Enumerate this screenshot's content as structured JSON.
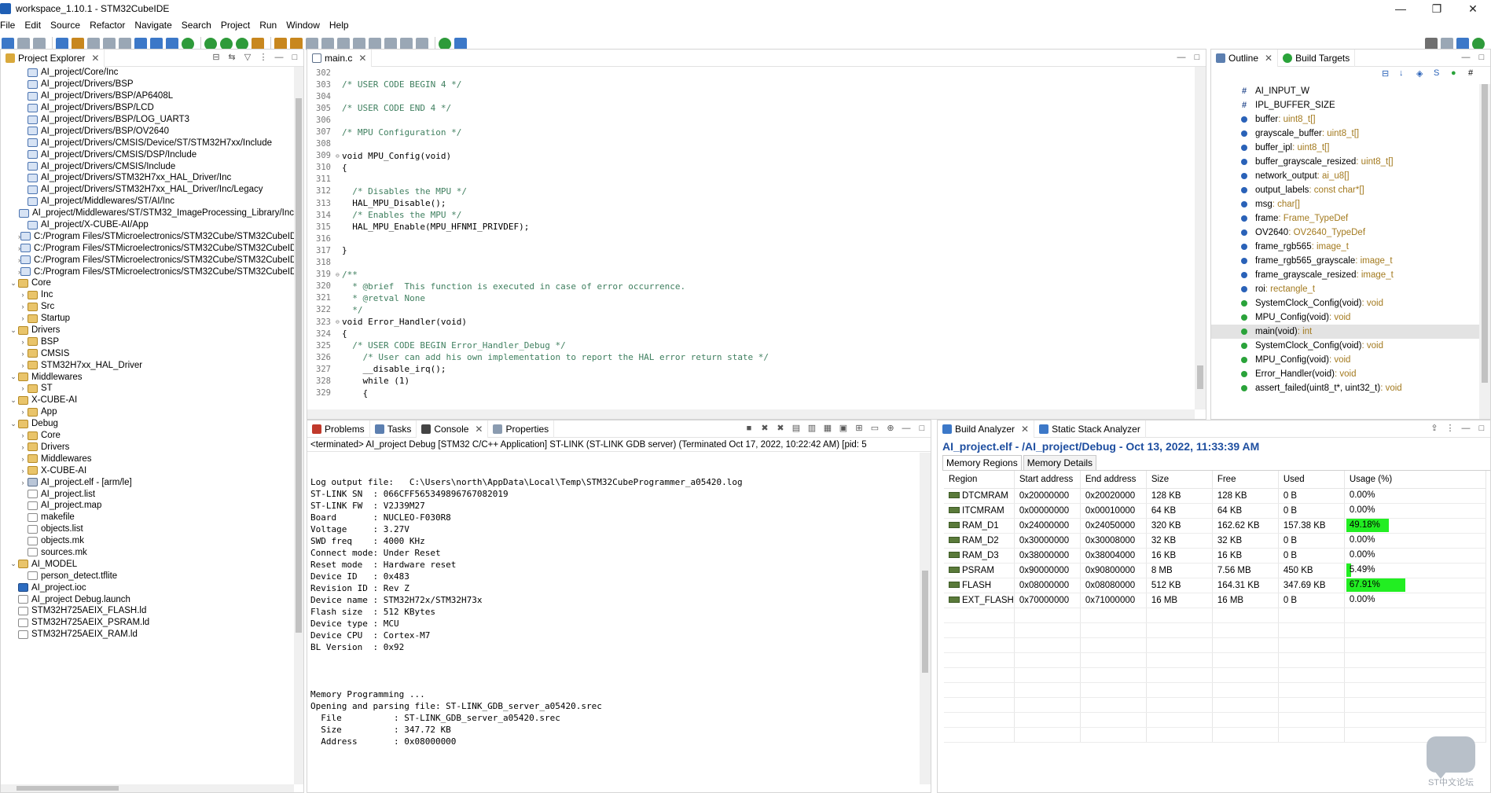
{
  "window": {
    "title": "workspace_1.10.1 - STM32CubeIDE",
    "controls": [
      "—",
      "❐",
      "✕"
    ]
  },
  "menu": [
    "File",
    "Edit",
    "Source",
    "Refactor",
    "Navigate",
    "Search",
    "Project",
    "Run",
    "Window",
    "Help"
  ],
  "project_explorer": {
    "tab": "Project Explorer",
    "items": [
      {
        "t": "AI_project/Core/Inc",
        "d": 2,
        "ic": "inc"
      },
      {
        "t": "AI_project/Drivers/BSP",
        "d": 2,
        "ic": "inc"
      },
      {
        "t": "AI_project/Drivers/BSP/AP6408L",
        "d": 2,
        "ic": "inc"
      },
      {
        "t": "AI_project/Drivers/BSP/LCD",
        "d": 2,
        "ic": "inc"
      },
      {
        "t": "AI_project/Drivers/BSP/LOG_UART3",
        "d": 2,
        "ic": "inc"
      },
      {
        "t": "AI_project/Drivers/BSP/OV2640",
        "d": 2,
        "ic": "inc"
      },
      {
        "t": "AI_project/Drivers/CMSIS/Device/ST/STM32H7xx/Include",
        "d": 2,
        "ic": "inc"
      },
      {
        "t": "AI_project/Drivers/CMSIS/DSP/Include",
        "d": 2,
        "ic": "inc"
      },
      {
        "t": "AI_project/Drivers/CMSIS/Include",
        "d": 2,
        "ic": "inc"
      },
      {
        "t": "AI_project/Drivers/STM32H7xx_HAL_Driver/Inc",
        "d": 2,
        "ic": "inc"
      },
      {
        "t": "AI_project/Drivers/STM32H7xx_HAL_Driver/Inc/Legacy",
        "d": 2,
        "ic": "inc"
      },
      {
        "t": "AI_project/Middlewares/ST/AI/Inc",
        "d": 2,
        "ic": "inc"
      },
      {
        "t": "AI_project/Middlewares/ST/STM32_ImageProcessing_Library/Inc",
        "d": 2,
        "ic": "inc"
      },
      {
        "t": "AI_project/X-CUBE-AI/App",
        "d": 2,
        "ic": "inc"
      },
      {
        "t": "C:/Program Files/STMicroelectronics/STM32Cube/STM32CubeIDE_1.10.1/S",
        "d": 2,
        "ic": "inc",
        "a": "›"
      },
      {
        "t": "C:/Program Files/STMicroelectronics/STM32Cube/STM32CubeIDE_1.10.1/S",
        "d": 2,
        "ic": "inc",
        "a": "›"
      },
      {
        "t": "C:/Program Files/STMicroelectronics/STM32Cube/STM32CubeIDE_1.10.1/S",
        "d": 2,
        "ic": "inc",
        "a": "›"
      },
      {
        "t": "C:/Program Files/STMicroelectronics/STM32Cube/STM32CubeIDE_1.10.1/S",
        "d": 2,
        "ic": "inc",
        "a": "›"
      },
      {
        "t": "Core",
        "d": 1,
        "ic": "folder",
        "a": "⌄"
      },
      {
        "t": "Inc",
        "d": 2,
        "ic": "folder",
        "a": "›"
      },
      {
        "t": "Src",
        "d": 2,
        "ic": "folder",
        "a": "›"
      },
      {
        "t": "Startup",
        "d": 2,
        "ic": "folder",
        "a": "›"
      },
      {
        "t": "Drivers",
        "d": 1,
        "ic": "folder",
        "a": "⌄"
      },
      {
        "t": "BSP",
        "d": 2,
        "ic": "folder",
        "a": "›"
      },
      {
        "t": "CMSIS",
        "d": 2,
        "ic": "folder",
        "a": "›"
      },
      {
        "t": "STM32H7xx_HAL_Driver",
        "d": 2,
        "ic": "folder",
        "a": "›"
      },
      {
        "t": "Middlewares",
        "d": 1,
        "ic": "folder",
        "a": "⌄"
      },
      {
        "t": "ST",
        "d": 2,
        "ic": "folder",
        "a": "›"
      },
      {
        "t": "X-CUBE-AI",
        "d": 1,
        "ic": "folder",
        "a": "⌄"
      },
      {
        "t": "App",
        "d": 2,
        "ic": "folder",
        "a": "›"
      },
      {
        "t": "Debug",
        "d": 1,
        "ic": "folder",
        "a": "⌄"
      },
      {
        "t": "Core",
        "d": 2,
        "ic": "folder",
        "a": "›"
      },
      {
        "t": "Drivers",
        "d": 2,
        "ic": "folder",
        "a": "›"
      },
      {
        "t": "Middlewares",
        "d": 2,
        "ic": "folder",
        "a": "›"
      },
      {
        "t": "X-CUBE-AI",
        "d": 2,
        "ic": "folder",
        "a": "›"
      },
      {
        "t": "AI_project.elf - [arm/le]",
        "d": 2,
        "ic": "bin",
        "a": "›"
      },
      {
        "t": "AI_project.list",
        "d": 2,
        "ic": "file"
      },
      {
        "t": "AI_project.map",
        "d": 2,
        "ic": "file"
      },
      {
        "t": "makefile",
        "d": 2,
        "ic": "file"
      },
      {
        "t": "objects.list",
        "d": 2,
        "ic": "file"
      },
      {
        "t": "objects.mk",
        "d": 2,
        "ic": "file"
      },
      {
        "t": "sources.mk",
        "d": 2,
        "ic": "file"
      },
      {
        "t": "AI_MODEL",
        "d": 1,
        "ic": "folder",
        "a": "⌄"
      },
      {
        "t": "person_detect.tflite",
        "d": 2,
        "ic": "file"
      },
      {
        "t": "AI_project.ioc",
        "d": 1,
        "ic": "mx"
      },
      {
        "t": "AI_project Debug.launch",
        "d": 1,
        "ic": "file"
      },
      {
        "t": "STM32H725AEIX_FLASH.ld",
        "d": 1,
        "ic": "file"
      },
      {
        "t": "STM32H725AEIX_PSRAM.ld",
        "d": 1,
        "ic": "file"
      },
      {
        "t": "STM32H725AEIX_RAM.ld",
        "d": 1,
        "ic": "file"
      }
    ]
  },
  "editor": {
    "tab": "main.c",
    "lines": [
      {
        "n": "302",
        "t": ""
      },
      {
        "n": "303",
        "t": "/* USER CODE BEGIN 4 */",
        "k": "cmt"
      },
      {
        "n": "304",
        "t": ""
      },
      {
        "n": "305",
        "t": "/* USER CODE END 4 */",
        "k": "cmt"
      },
      {
        "n": "306",
        "t": ""
      },
      {
        "n": "307",
        "t": "/* MPU Configuration */",
        "k": "cmt"
      },
      {
        "n": "308",
        "t": ""
      },
      {
        "n": "309",
        "t": "void MPU_Config(void)",
        "f": "⊖"
      },
      {
        "n": "310",
        "t": "{"
      },
      {
        "n": "311",
        "t": ""
      },
      {
        "n": "312",
        "t": "  /* Disables the MPU */",
        "k": "cmt"
      },
      {
        "n": "313",
        "t": "  HAL_MPU_Disable();"
      },
      {
        "n": "314",
        "t": "  /* Enables the MPU */",
        "k": "cmt"
      },
      {
        "n": "315",
        "t": "  HAL_MPU_Enable(MPU_HFNMI_PRIVDEF);"
      },
      {
        "n": "316",
        "t": ""
      },
      {
        "n": "317",
        "t": "}"
      },
      {
        "n": "318",
        "t": ""
      },
      {
        "n": "319",
        "t": "/**",
        "k": "cmt",
        "f": "⊖"
      },
      {
        "n": "320",
        "t": "  * @brief  This function is executed in case of error occurrence.",
        "k": "cmt"
      },
      {
        "n": "321",
        "t": "  * @retval None",
        "k": "cmt"
      },
      {
        "n": "322",
        "t": "  */",
        "k": "cmt"
      },
      {
        "n": "323",
        "t": "void Error_Handler(void)",
        "f": "⊖"
      },
      {
        "n": "324",
        "t": "{"
      },
      {
        "n": "325",
        "t": "  /* USER CODE BEGIN Error_Handler_Debug */",
        "k": "cmt"
      },
      {
        "n": "326",
        "t": "    /* User can add his own implementation to report the HAL error return state */",
        "k": "cmt"
      },
      {
        "n": "327",
        "t": "    __disable_irq();"
      },
      {
        "n": "328",
        "t": "    while (1)"
      },
      {
        "n": "329",
        "t": "    {"
      }
    ]
  },
  "outline": {
    "tabs": [
      "Outline",
      "Build Targets"
    ],
    "items": [
      {
        "name": "AI_INPUT_W",
        "type": "",
        "icon": "#"
      },
      {
        "name": "IPL_BUFFER_SIZE",
        "type": "",
        "icon": "#"
      },
      {
        "name": "buffer",
        "type": " : uint8_t[]",
        "icon": "dot-blue"
      },
      {
        "name": "grayscale_buffer",
        "type": " : uint8_t[]",
        "icon": "dot-blue"
      },
      {
        "name": "buffer_ipl",
        "type": " : uint8_t[]",
        "icon": "dot-blue"
      },
      {
        "name": "buffer_grayscale_resized",
        "type": " : uint8_t[]",
        "icon": "dot-blue"
      },
      {
        "name": "network_output",
        "type": " : ai_u8[]",
        "icon": "dot-blue"
      },
      {
        "name": "output_labels",
        "type": " : const char*[]",
        "icon": "dot-blue"
      },
      {
        "name": "msg",
        "type": " : char[]",
        "icon": "dot-blue"
      },
      {
        "name": "frame",
        "type": " : Frame_TypeDef",
        "icon": "dot-blue"
      },
      {
        "name": "OV2640",
        "type": " : OV2640_TypeDef",
        "icon": "dot-blue"
      },
      {
        "name": "frame_rgb565",
        "type": " : image_t",
        "icon": "dot-blue"
      },
      {
        "name": "frame_rgb565_grayscale",
        "type": " : image_t",
        "icon": "dot-blue"
      },
      {
        "name": "frame_grayscale_resized",
        "type": " : image_t",
        "icon": "dot-blue"
      },
      {
        "name": "roi",
        "type": " : rectangle_t",
        "icon": "dot-blue"
      },
      {
        "name": "SystemClock_Config(void)",
        "type": " : void",
        "icon": "dot-green"
      },
      {
        "name": "MPU_Config(void)",
        "type": " : void",
        "icon": "dot-green"
      },
      {
        "name": "main(void)",
        "type": " : int",
        "icon": "dot-green",
        "sel": true
      },
      {
        "name": "SystemClock_Config(void)",
        "type": " : void",
        "icon": "dot-green"
      },
      {
        "name": "MPU_Config(void)",
        "type": " : void",
        "icon": "dot-green"
      },
      {
        "name": "Error_Handler(void)",
        "type": " : void",
        "icon": "dot-green"
      },
      {
        "name": "assert_failed(uint8_t*, uint32_t)",
        "type": " : void",
        "icon": "dot-green"
      }
    ]
  },
  "console": {
    "tabs": [
      "Problems",
      "Tasks",
      "Console",
      "Properties"
    ],
    "terminated": "<terminated> AI_project Debug [STM32 C/C++ Application] ST-LINK (ST-LINK GDB server) (Terminated Oct 17, 2022, 10:22:42 AM) [pid: 5",
    "lines": [
      "",
      "",
      "Log output file:   C:\\Users\\north\\AppData\\Local\\Temp\\STM32CubeProgrammer_a05420.log",
      "ST-LINK SN  : 066CFF565349896767082019",
      "ST-LINK FW  : V2J39M27",
      "Board       : NUCLEO-F030R8",
      "Voltage     : 3.27V",
      "SWD freq    : 4000 KHz",
      "Connect mode: Under Reset",
      "Reset mode  : Hardware reset",
      "Device ID   : 0x483",
      "Revision ID : Rev Z",
      "Device name : STM32H72x/STM32H73x",
      "Flash size  : 512 KBytes",
      "Device type : MCU",
      "Device CPU  : Cortex-M7",
      "BL Version  : 0x92",
      "",
      "",
      "",
      "Memory Programming ...",
      "Opening and parsing file: ST-LINK_GDB_server_a05420.srec",
      "  File          : ST-LINK_GDB_server_a05420.srec",
      "  Size          : 347.72 KB",
      "  Address       : 0x08000000"
    ]
  },
  "build_analyzer": {
    "tabs": [
      "Build Analyzer",
      "Static Stack Analyzer"
    ],
    "title": "AI_project.elf - /AI_project/Debug - Oct 13, 2022, 11:33:39 AM",
    "subtabs": [
      "Memory Regions",
      "Memory Details"
    ],
    "headers": [
      "Region",
      "Start address",
      "End address",
      "Size",
      "Free",
      "Used",
      "Usage (%)"
    ],
    "rows": [
      {
        "region": "DTCMRAM",
        "start": "0x20000000",
        "end": "0x20020000",
        "size": "128 KB",
        "free": "128 KB",
        "used": "0 B",
        "usage": "0.00%",
        "pct": 0
      },
      {
        "region": "ITCMRAM",
        "start": "0x00000000",
        "end": "0x00010000",
        "size": "64 KB",
        "free": "64 KB",
        "used": "0 B",
        "usage": "0.00%",
        "pct": 0
      },
      {
        "region": "RAM_D1",
        "start": "0x24000000",
        "end": "0x24050000",
        "size": "320 KB",
        "free": "162.62 KB",
        "used": "157.38 KB",
        "usage": "49.18%",
        "pct": 49.18
      },
      {
        "region": "RAM_D2",
        "start": "0x30000000",
        "end": "0x30008000",
        "size": "32 KB",
        "free": "32 KB",
        "used": "0 B",
        "usage": "0.00%",
        "pct": 0
      },
      {
        "region": "RAM_D3",
        "start": "0x38000000",
        "end": "0x38004000",
        "size": "16 KB",
        "free": "16 KB",
        "used": "0 B",
        "usage": "0.00%",
        "pct": 0
      },
      {
        "region": "PSRAM",
        "start": "0x90000000",
        "end": "0x90800000",
        "size": "8 MB",
        "free": "7.56 MB",
        "used": "450 KB",
        "usage": "5.49%",
        "pct": 5.49
      },
      {
        "region": "FLASH",
        "start": "0x08000000",
        "end": "0x08080000",
        "size": "512 KB",
        "free": "164.31 KB",
        "used": "347.69 KB",
        "usage": "67.91%",
        "pct": 67.91
      },
      {
        "region": "EXT_FLASH",
        "start": "0x70000000",
        "end": "0x71000000",
        "size": "16 MB",
        "free": "16 MB",
        "used": "0 B",
        "usage": "0.00%",
        "pct": 0
      }
    ]
  },
  "watermark": "ST中文论坛"
}
